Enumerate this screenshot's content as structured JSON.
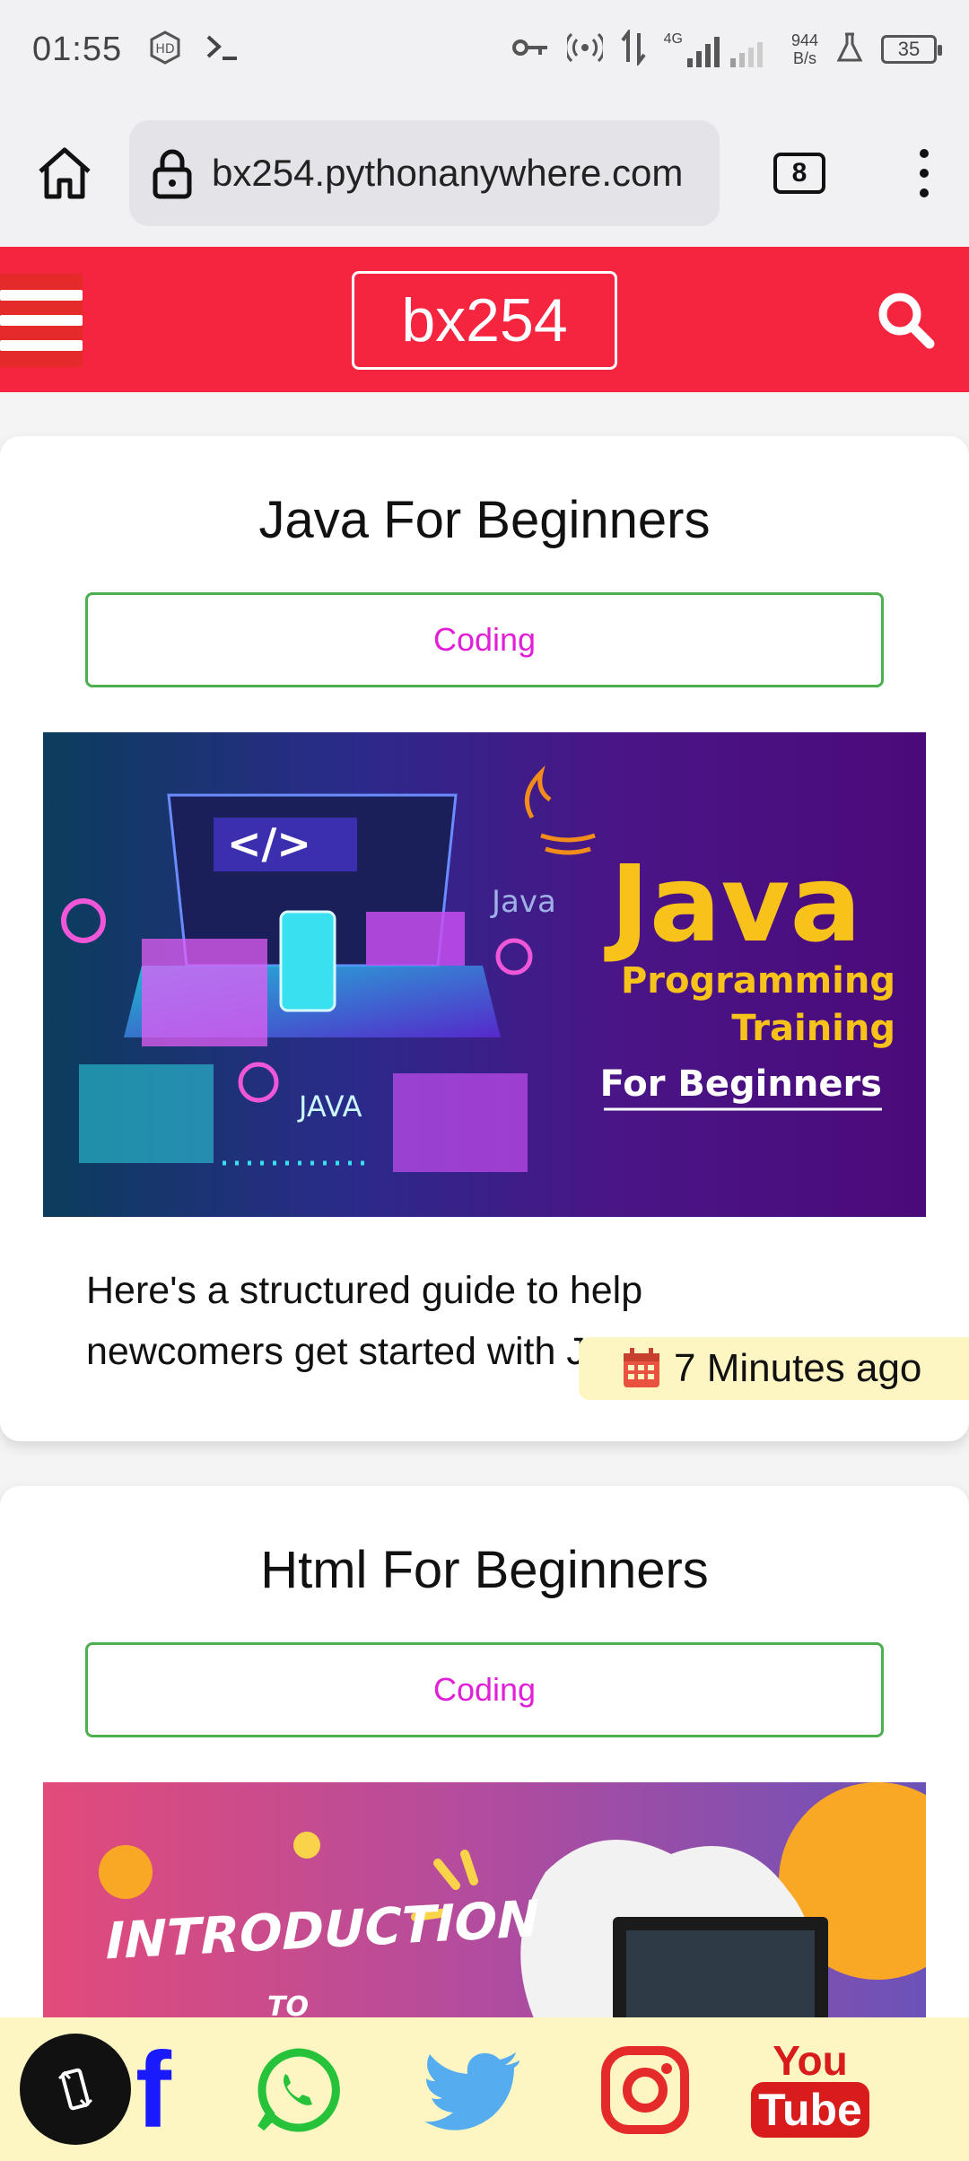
{
  "status_bar": {
    "time": "01:55",
    "network": "4G",
    "speed_value": "944",
    "speed_unit": "B/s",
    "battery": "35"
  },
  "browser": {
    "url": "bx254.pythonanywhere.com",
    "tab_count": "8"
  },
  "site": {
    "brand": "bx254",
    "accent_color": "#f5243f"
  },
  "posts": [
    {
      "title": "Java For Beginners",
      "category": "Coding",
      "image_text": {
        "headline": "Java",
        "line1": "Programming",
        "line2": "Training",
        "line3": "For Beginners",
        "logo_label": "Java",
        "chip_label": "JAVA",
        "code_tag": "</>"
      },
      "excerpt": "Here's a structured guide to help newcomers get started with J",
      "time_ago": "7 Minutes ago"
    },
    {
      "title": "Html For Beginners",
      "category": "Coding",
      "image_text": {
        "headline": "INTRODUCTION",
        "line1": "TO"
      }
    }
  ],
  "social": {
    "facebook": "f",
    "youtube_top": "You",
    "youtube_bottom": "Tube"
  }
}
